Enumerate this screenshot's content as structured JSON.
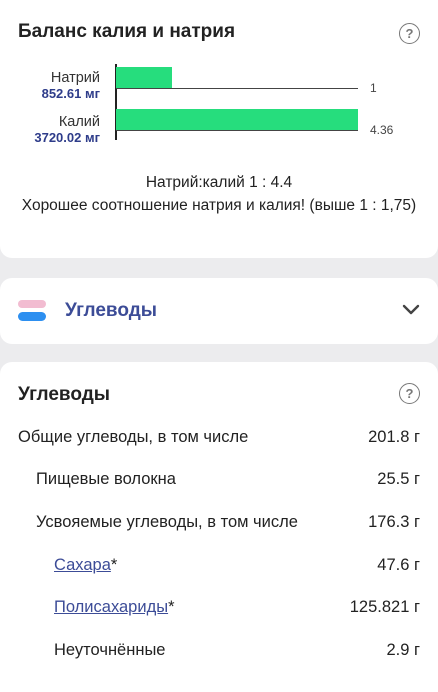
{
  "balance": {
    "title": "Баланс калия и натрия",
    "help_icon": "question-circle-icon",
    "bars": [
      {
        "name": "Натрий",
        "amount": "852.61 мг",
        "ratio": 1,
        "ratio_label": "1"
      },
      {
        "name": "Калий",
        "amount": "3720.02 мг",
        "ratio": 4.36,
        "ratio_label": "4.36"
      }
    ],
    "bar_color": "#26dd7d",
    "ratio_line": "Натрий:калий 1 : 4.4",
    "assessment": "Хорошее соотношение натрия и калия! (выше 1 : 1,75)"
  },
  "carbs_collapsed": {
    "title": "Углеводы",
    "icon": "pills-icon",
    "chevron": "chevron-down-icon"
  },
  "carbs_detail": {
    "title": "Углеводы",
    "help_icon": "question-circle-icon",
    "rows": [
      {
        "name": "Общие углеводы, в том числе",
        "value": "201.8 г"
      },
      {
        "name": "Пищевые волокна",
        "value": "25.5 г"
      },
      {
        "name": "Усвояемые углеводы, в том числе",
        "value": "176.3 г"
      },
      {
        "name": "Сахара",
        "suffix": "*",
        "value": "47.6 г",
        "link": true
      },
      {
        "name": "Полисахариды",
        "suffix": "*",
        "value": "125.821 г",
        "link": true
      },
      {
        "name": "Неуточнённые",
        "value": "2.9 г"
      }
    ]
  },
  "colors": {
    "accent": "#3c4c97",
    "background": "#ececee"
  }
}
